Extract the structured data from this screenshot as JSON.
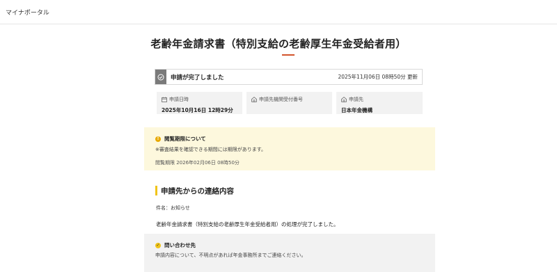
{
  "header": {
    "brand": "マイナポータル"
  },
  "page": {
    "title": "老齢年金請求書（特別支給の老齢厚生年金受給者用）"
  },
  "status": {
    "label": "申請が完了しました",
    "updated": "2025年11月06日 08時50分 更新"
  },
  "info_cards": [
    {
      "label": "申請日時",
      "value": "2025年10月16日 12時29分",
      "icon": "calendar-icon"
    },
    {
      "label": "申請先機関受付番号",
      "value": "",
      "icon": "building-icon"
    },
    {
      "label": "申請先",
      "value": "日本年金機構",
      "icon": "building-icon"
    }
  ],
  "notice": {
    "heading": "閲覧期限について",
    "text": "※審査結果を確認できる期間には期限があります。",
    "deadline": "閲覧期限 2026年02月06日 08時50分"
  },
  "contact_section": {
    "title": "申請先からの連絡内容",
    "subject": "件名：お知らせ",
    "message": "老齢年金請求書（特別支給の老齢厚生年金受給者用）の処理が完了しました。"
  },
  "inquiry": {
    "heading": "問い合わせ先",
    "text": "申請内容について、不明点があれば年金事務所までご連絡ください。"
  },
  "colors": {
    "accent": "#d2542b",
    "notice_bg": "#fdf8dd",
    "section_bar": "#f0c419",
    "card_bg": "#f2f2f2"
  }
}
